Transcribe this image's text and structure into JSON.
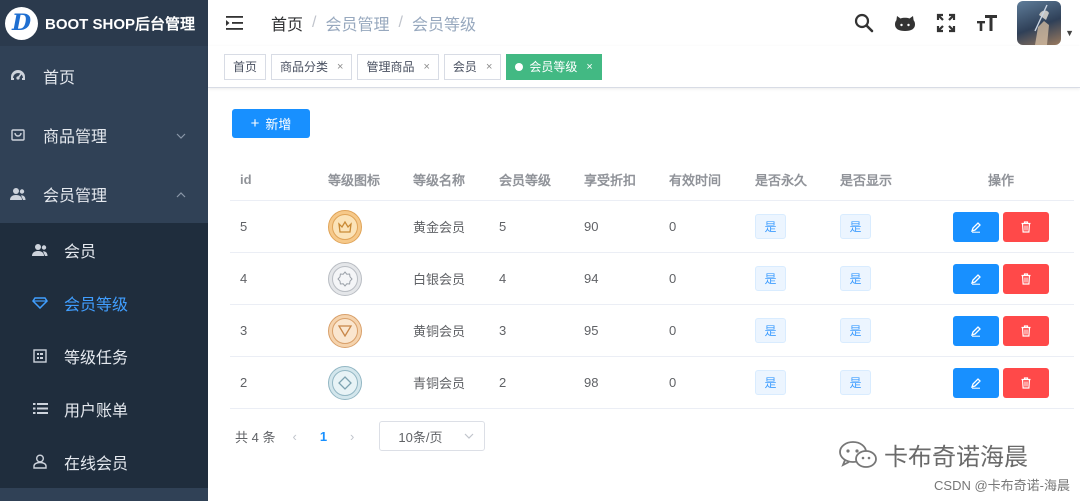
{
  "brand": {
    "logo_letter": "D",
    "title": "BOOT SHOP后台管理"
  },
  "sidebar": {
    "items": [
      {
        "label": "首页",
        "icon": "dashboard-icon"
      },
      {
        "label": "商品管理",
        "icon": "goods-icon"
      },
      {
        "label": "会员管理",
        "icon": "members-icon"
      }
    ],
    "subitems": [
      {
        "label": "会员",
        "icon": "user-icon"
      },
      {
        "label": "会员等级",
        "icon": "diamond-icon"
      },
      {
        "label": "等级任务",
        "icon": "task-icon"
      },
      {
        "label": "用户账单",
        "icon": "list-icon"
      },
      {
        "label": "在线会员",
        "icon": "online-user-icon"
      }
    ],
    "active_color": "#409eff"
  },
  "header": {
    "breadcrumb": [
      "首页",
      "会员管理",
      "会员等级"
    ],
    "separator": "/"
  },
  "tags": [
    {
      "label": "首页",
      "closable": false
    },
    {
      "label": "商品分类",
      "closable": true
    },
    {
      "label": "管理商品",
      "closable": true
    },
    {
      "label": "会员",
      "closable": true
    },
    {
      "label": "会员等级",
      "closable": true,
      "active": true
    }
  ],
  "tag_close": "×",
  "toolbar": {
    "add_label": "新增",
    "add_icon": "+"
  },
  "table": {
    "columns": [
      "id",
      "等级图标",
      "等级名称",
      "会员等级",
      "享受折扣",
      "有效时间",
      "是否永久",
      "是否显示",
      "操作"
    ],
    "rows": [
      {
        "id": "5",
        "medal": "gold",
        "name": "黄金会员",
        "level": "5",
        "discount": "90",
        "time": "0",
        "permanent": "是",
        "show": "是"
      },
      {
        "id": "4",
        "medal": "silver",
        "name": "白银会员",
        "level": "4",
        "discount": "94",
        "time": "0",
        "permanent": "是",
        "show": "是"
      },
      {
        "id": "3",
        "medal": "bronze",
        "name": "黄铜会员",
        "level": "3",
        "discount": "95",
        "time": "0",
        "permanent": "是",
        "show": "是"
      },
      {
        "id": "2",
        "medal": "cyan",
        "name": "青铜会员",
        "level": "2",
        "discount": "98",
        "time": "0",
        "permanent": "是",
        "show": "是"
      }
    ]
  },
  "pagination": {
    "total_text": "共 4 条",
    "prev": "‹",
    "current": "1",
    "next": "›",
    "page_size": "10条/页"
  },
  "watermark": {
    "main": "卡布奇诺海晨",
    "sub": "CSDN @卡布奇诺-海晨"
  },
  "colors": {
    "sidebar_bg": "#304156",
    "primary": "#1890ff",
    "danger": "#ff4949",
    "tag_active": "#42b983"
  }
}
